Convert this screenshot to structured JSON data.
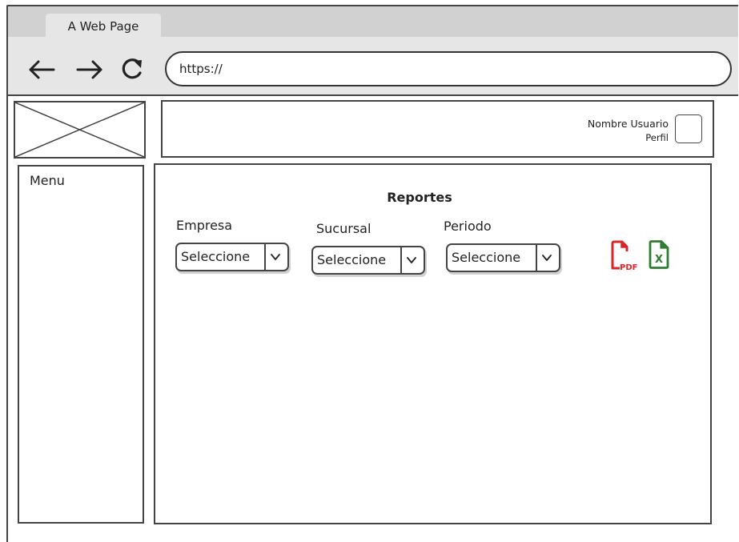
{
  "browser": {
    "tab_title": "A Web Page",
    "address": "https://",
    "nav_icons": [
      "back-arrow-icon",
      "forward-arrow-icon",
      "reload-icon"
    ]
  },
  "header": {
    "user_name": "Nombre Usuario",
    "user_profile": "Perfil"
  },
  "sidebar": {
    "title": "Menu"
  },
  "main": {
    "title": "Reportes",
    "filters": [
      {
        "label": "Empresa",
        "selected": "Seleccione"
      },
      {
        "label": "Sucursal",
        "selected": "Seleccione"
      },
      {
        "label": "Periodo",
        "selected": "Seleccione"
      }
    ],
    "export_icons": [
      {
        "name": "pdf-icon",
        "text": "PDF",
        "color": "#d9262b"
      },
      {
        "name": "excel-icon",
        "text": "X",
        "color": "#2e7d32"
      }
    ]
  }
}
